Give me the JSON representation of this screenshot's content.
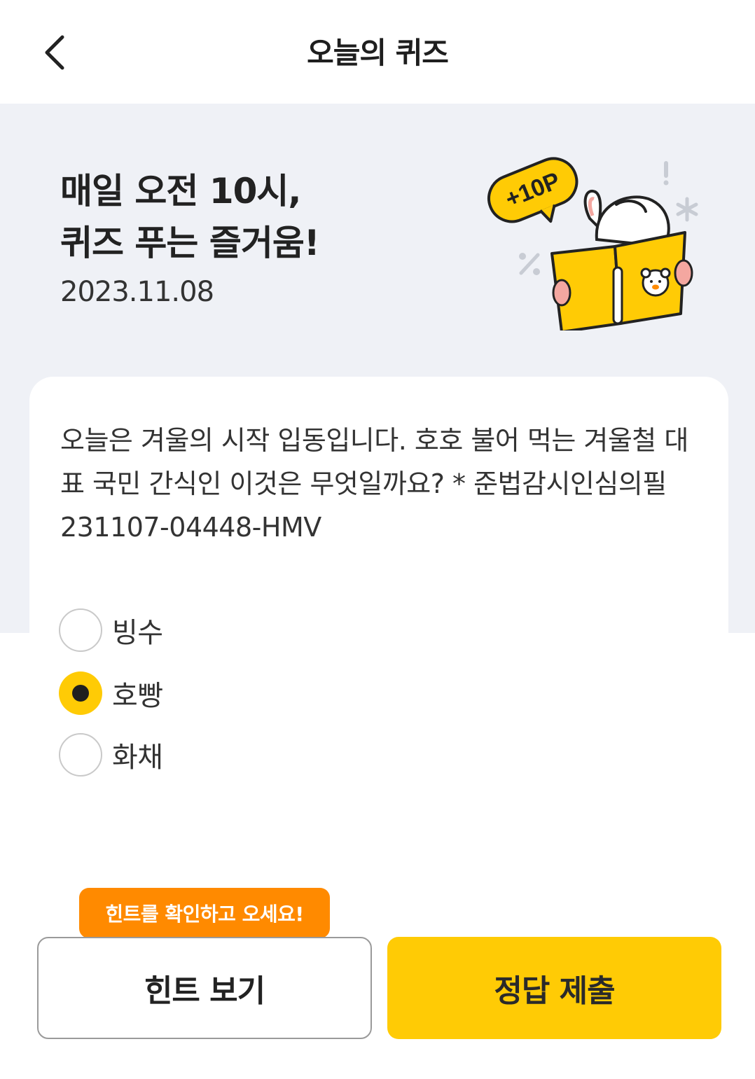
{
  "header": {
    "title": "오늘의 퀴즈",
    "back_icon": "chevron-left-icon"
  },
  "hero": {
    "title_line1": "매일 오전 10시,",
    "title_line2": "퀴즈 푸는 즐거움!",
    "date": "2023.11.08",
    "badge_text": "+10P",
    "bg_color": "#eff1f6"
  },
  "quiz": {
    "question": "오늘은 겨울의 시작 입동입니다. 호호 불어 먹는 겨울철 대표 국민 간식인 이것은 무엇일까요? * 준법감시인심의필231107-04448-HMV",
    "options": [
      {
        "label": "빙수",
        "selected": false
      },
      {
        "label": "호빵",
        "selected": true
      },
      {
        "label": "화채",
        "selected": false
      }
    ]
  },
  "footer": {
    "tooltip": "힌트를 확인하고 오세요!",
    "hint_button": "힌트 보기",
    "submit_button": "정답 제출"
  },
  "colors": {
    "accent": "#ffcb05",
    "tooltip": "#ff8a00"
  }
}
